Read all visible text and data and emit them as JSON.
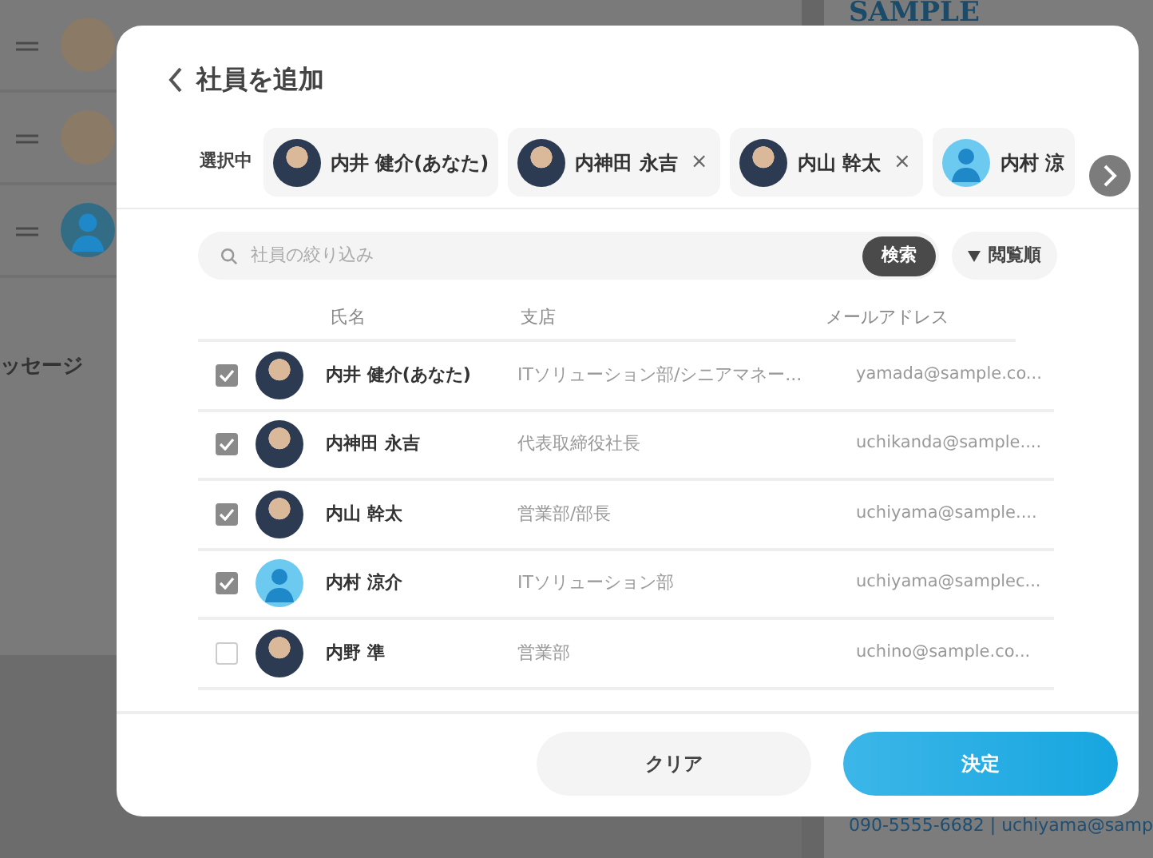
{
  "background": {
    "logo": "SAMPLE",
    "rows": [
      {
        "avatar": {
          "kind": "photo"
        }
      },
      {
        "avatar": {
          "kind": "photo"
        }
      },
      {
        "avatar": {
          "kind": "silhouette"
        }
      }
    ],
    "message_label": "ッセージ",
    "contact": "090-5555-6682 | uchiyama@samp"
  },
  "dialog": {
    "title": "社員を追加",
    "selected_label": "選択中",
    "selected": [
      {
        "name": "内井 健介(あなた)",
        "avatar": {
          "kind": "photo"
        }
      },
      {
        "name": "内神田 永吉",
        "avatar": {
          "kind": "photo"
        },
        "remove": "×"
      },
      {
        "name": "内山 幹太",
        "avatar": {
          "kind": "photo"
        },
        "remove": "×"
      },
      {
        "name": "内村 涼",
        "avatar": {
          "kind": "silhouette"
        }
      }
    ],
    "search": {
      "placeholder": "社員の絞り込み",
      "button": "検索"
    },
    "sort": {
      "label": "閲覧順"
    },
    "table": {
      "columns": [
        "氏名",
        "支店",
        "メールアドレス"
      ],
      "rows": [
        {
          "checked": true,
          "avatar": {
            "kind": "photo"
          },
          "name": "内井 健介(あなた)",
          "department": "ITソリューション部/シニアマネー...",
          "email": "yamada@sample.co..."
        },
        {
          "checked": true,
          "avatar": {
            "kind": "photo"
          },
          "name": "内神田 永吉",
          "department": "代表取締役社長",
          "email": "uchikanda@sample...."
        },
        {
          "checked": true,
          "avatar": {
            "kind": "photo"
          },
          "name": "内山 幹太",
          "department": "営業部/部長",
          "email": "uchiyama@sample...."
        },
        {
          "checked": true,
          "avatar": {
            "kind": "silhouette"
          },
          "name": "内村 涼介",
          "department": "ITソリューション部",
          "email": "uchiyama@samplec..."
        },
        {
          "checked": false,
          "avatar": {
            "kind": "photo"
          },
          "name": "内野 準",
          "department": "営業部",
          "email": "uchino@sample.co..."
        }
      ]
    },
    "buttons": [
      {
        "label": "クリア",
        "kind": "secondary"
      },
      {
        "label": "決定",
        "kind": "primary"
      }
    ]
  }
}
